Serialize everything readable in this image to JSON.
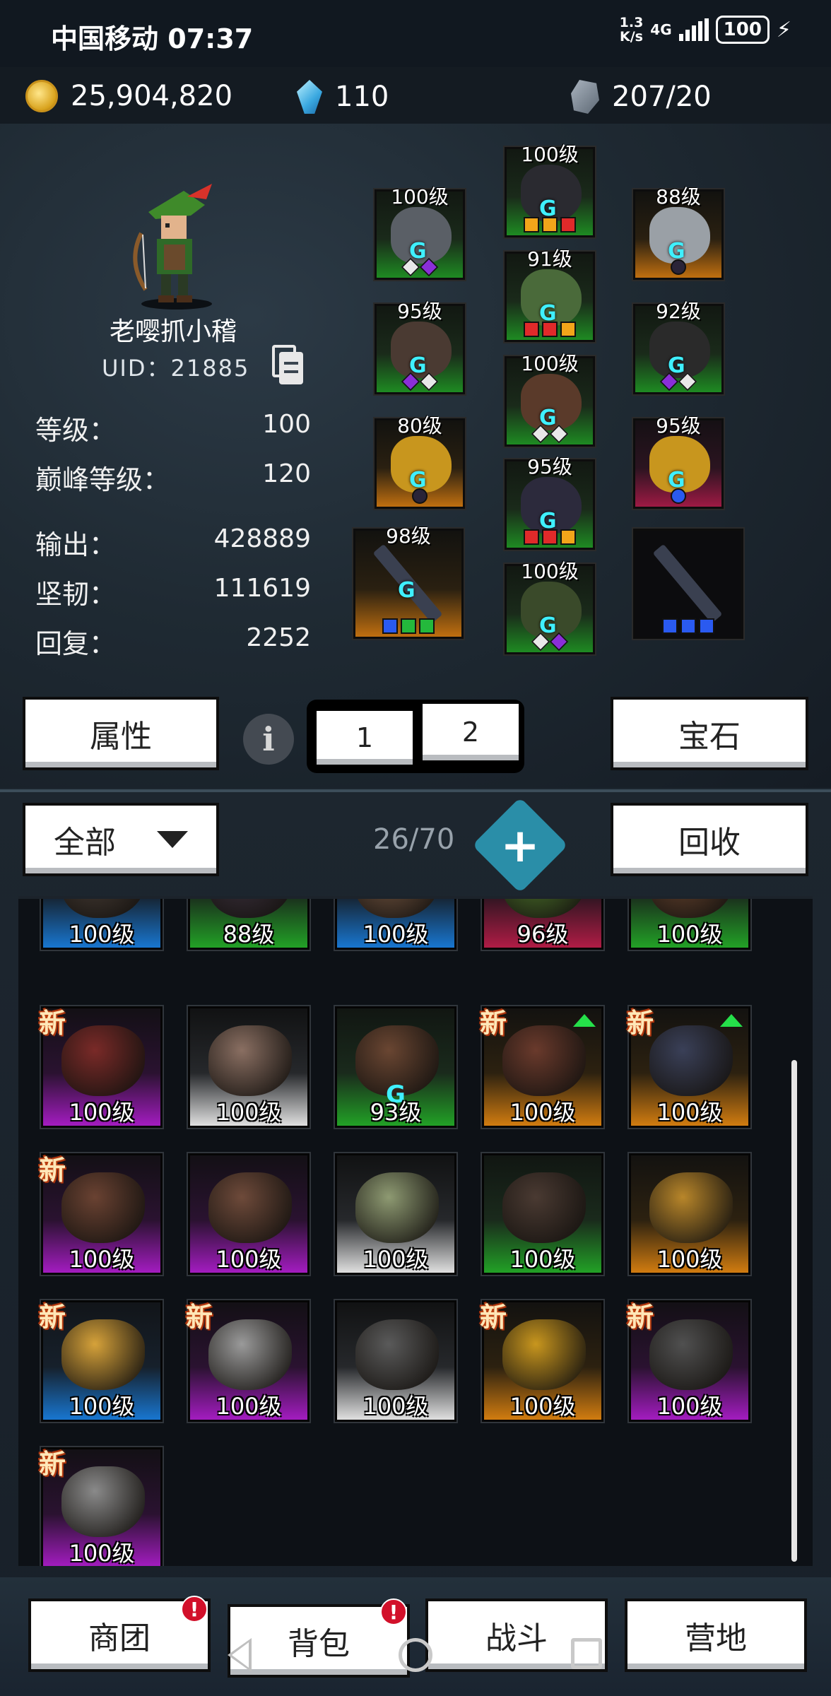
{
  "status_bar": {
    "carrier": "中国移动",
    "time": "07:37",
    "speed_value": "1.3",
    "speed_unit": "K/s",
    "network": "4G",
    "battery": "100"
  },
  "currency": {
    "gold": "25,904,820",
    "diamond": "110",
    "stone": "207/20"
  },
  "hero": {
    "name": "老嘤抓小稽",
    "uid": "UID：21885"
  },
  "stats": [
    {
      "label": "等级：",
      "value": "100"
    },
    {
      "label": "巅峰等级：",
      "value": "120"
    },
    {
      "label": "输出：",
      "value": "428889"
    },
    {
      "label": "坚韧：",
      "value": "111619"
    },
    {
      "label": "回复：",
      "value": "2252"
    }
  ],
  "equipment": [
    {
      "level": "100级",
      "rarity": "green",
      "icon": "gauntlet-icon",
      "sockets": [
        "white",
        "purple"
      ]
    },
    {
      "level": "95级",
      "rarity": "green",
      "icon": "gloves-icon",
      "sockets": [
        "purple",
        "white"
      ]
    },
    {
      "level": "80级",
      "rarity": "orange",
      "icon": "ring-icon",
      "sockets": [
        "dark"
      ]
    },
    {
      "level": "98级",
      "rarity": "orange",
      "icon": "sword-icon",
      "sockets": [
        "blue",
        "green",
        "green"
      ]
    },
    {
      "level": "100级",
      "rarity": "green",
      "icon": "helmet-icon",
      "sockets": [
        "orange",
        "orange",
        "red"
      ]
    },
    {
      "level": "91级",
      "rarity": "green",
      "icon": "armor-icon",
      "sockets": [
        "red",
        "red",
        "orange"
      ]
    },
    {
      "level": "100级",
      "rarity": "green",
      "icon": "belt-icon",
      "sockets": [
        "white",
        "white"
      ]
    },
    {
      "level": "95级",
      "rarity": "green",
      "icon": "pants-icon",
      "sockets": [
        "red",
        "red",
        "orange"
      ]
    },
    {
      "level": "100级",
      "rarity": "green",
      "icon": "boots-icon",
      "sockets": [
        "white",
        "purple"
      ]
    },
    {
      "level": "88级",
      "rarity": "orange",
      "icon": "necklace-icon",
      "sockets": [
        "dark"
      ]
    },
    {
      "level": "92级",
      "rarity": "green",
      "icon": "bracer-icon",
      "sockets": [
        "purple",
        "white"
      ]
    },
    {
      "level": "95级",
      "rarity": "red",
      "icon": "ring-icon",
      "sockets": [
        "blue"
      ]
    },
    {
      "level": "",
      "rarity": "dark",
      "icon": "sword-icon",
      "sockets": [
        "blue",
        "blue",
        "blue"
      ]
    }
  ],
  "tabs": {
    "attributes": "属性",
    "page1": "1",
    "page2": "2",
    "gems": "宝石"
  },
  "inventory_toolbar": {
    "filter": "全部",
    "count": "26/70",
    "recycle": "回收"
  },
  "new_badge": "新",
  "inventory": [
    {
      "level": "100级",
      "rarity": "blue",
      "new": false,
      "up": false,
      "rune": false,
      "art": "#4a3f38"
    },
    {
      "level": "88级",
      "rarity": "green",
      "new": false,
      "up": false,
      "rune": false,
      "art": "#3d3240"
    },
    {
      "level": "100级",
      "rarity": "blue",
      "new": false,
      "up": false,
      "rune": false,
      "art": "#7a5a44"
    },
    {
      "level": "96级",
      "rarity": "red",
      "new": false,
      "up": false,
      "rune": false,
      "art": "#4f7a2c"
    },
    {
      "level": "100级",
      "rarity": "green",
      "new": false,
      "up": false,
      "rune": false,
      "art": "#6b4630"
    },
    {
      "level": "100级",
      "rarity": "purple",
      "new": true,
      "up": false,
      "rune": false,
      "art": "#7a2a28"
    },
    {
      "level": "100级",
      "rarity": "white",
      "new": false,
      "up": false,
      "rune": false,
      "art": "#8a6f62"
    },
    {
      "level": "93级",
      "rarity": "green",
      "new": false,
      "up": false,
      "rune": true,
      "art": "#6a4632"
    },
    {
      "level": "100级",
      "rarity": "orange",
      "new": true,
      "up": true,
      "rune": false,
      "art": "#6a3a2c"
    },
    {
      "level": "100级",
      "rarity": "orange",
      "new": true,
      "up": true,
      "rune": false,
      "art": "#3a4058"
    },
    {
      "level": "100级",
      "rarity": "purple",
      "new": true,
      "up": false,
      "rune": false,
      "art": "#6a4232"
    },
    {
      "level": "100级",
      "rarity": "purple",
      "new": false,
      "up": false,
      "rune": false,
      "art": "#6e4a3a"
    },
    {
      "level": "100级",
      "rarity": "white",
      "new": false,
      "up": false,
      "rune": false,
      "art": "#8e9a72"
    },
    {
      "level": "100级",
      "rarity": "green",
      "new": false,
      "up": false,
      "rune": false,
      "art": "#4a3a32"
    },
    {
      "level": "100级",
      "rarity": "orange",
      "new": false,
      "up": false,
      "rune": false,
      "art": "#b8862a"
    },
    {
      "level": "100级",
      "rarity": "blue",
      "new": true,
      "up": false,
      "rune": false,
      "art": "#d6a23a"
    },
    {
      "level": "100级",
      "rarity": "purple",
      "new": true,
      "up": false,
      "rune": false,
      "art": "#9a9a9a"
    },
    {
      "level": "100级",
      "rarity": "white",
      "new": false,
      "up": false,
      "rune": false,
      "art": "#5a5a5a"
    },
    {
      "level": "100级",
      "rarity": "orange",
      "new": true,
      "up": false,
      "rune": false,
      "art": "#c8961e"
    },
    {
      "level": "100级",
      "rarity": "purple",
      "new": true,
      "up": false,
      "rune": false,
      "art": "#505050"
    },
    {
      "level": "100级",
      "rarity": "purple",
      "new": true,
      "up": false,
      "rune": false,
      "art": "#8a8a8a"
    }
  ],
  "bottom_nav": [
    {
      "label": "商团",
      "badge": "!"
    },
    {
      "label": "背包",
      "badge": "!"
    },
    {
      "label": "战斗",
      "badge": ""
    },
    {
      "label": "营地",
      "badge": ""
    }
  ],
  "colors": {
    "green": "#22a126",
    "orange": "#d17c10",
    "red": "#b01c45",
    "purple": "#a31cc0",
    "blue": "#1876d0",
    "white": "#e0e0e0",
    "accent": "#2a8ea8"
  }
}
